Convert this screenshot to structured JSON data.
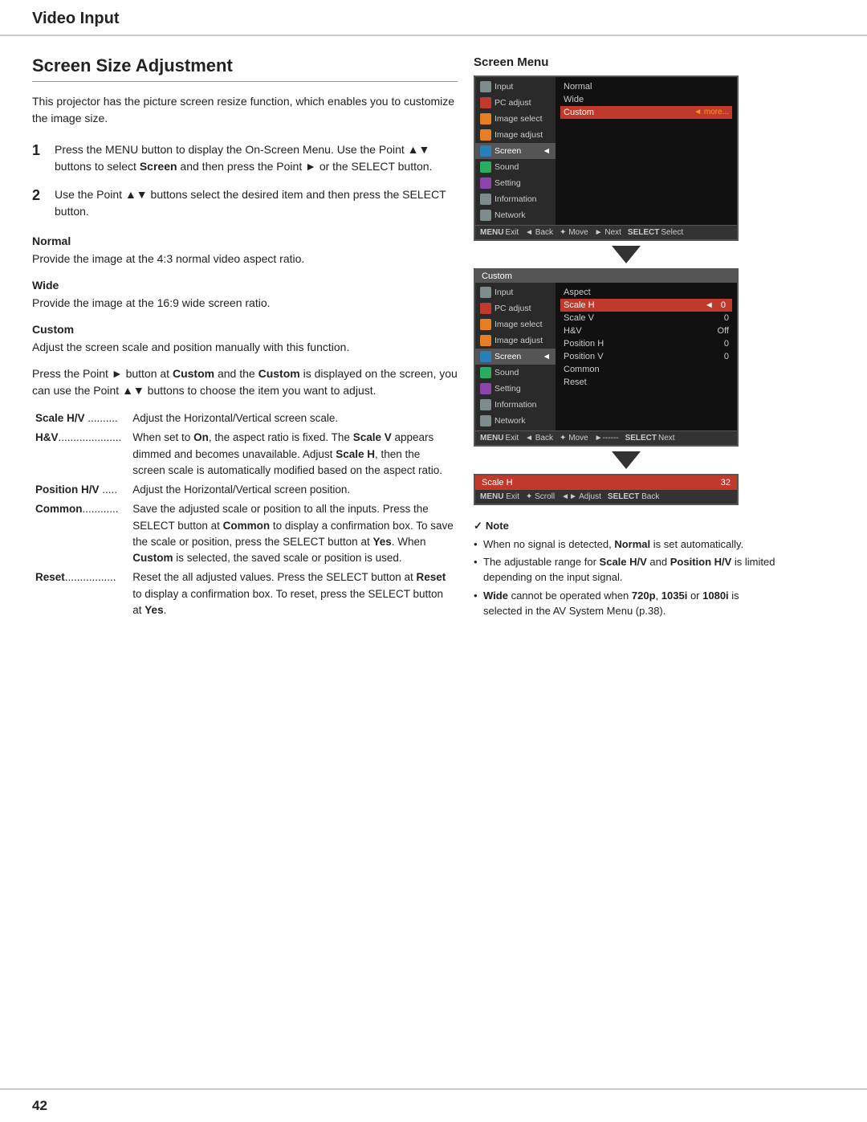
{
  "header": {
    "title": "Video Input"
  },
  "page": {
    "section_title": "Screen Size Adjustment",
    "intro": "This projector has the picture screen resize function, which enables you to customize the image size.",
    "steps": [
      {
        "num": "1",
        "text": "Press the MENU button to display the On-Screen Menu. Use the Point ▲▼ buttons to select Screen and then press the Point ► or the SELECT button."
      },
      {
        "num": "2",
        "text": "Use the Point ▲▼ buttons select the desired item and then press the SELECT button."
      }
    ],
    "normal_label": "Normal",
    "normal_desc": "Provide the image at the 4:3 normal video aspect ratio.",
    "wide_label": "Wide",
    "wide_desc": "Provide the image at the 16:9 wide screen ratio.",
    "custom_label": "Custom",
    "custom_desc1": "Adjust the screen scale and position manually with this function.",
    "custom_desc2": "Press the Point ► button at Custom and the Custom is displayed on the screen, you can use the Point ▲▼ buttons to choose the item you want to adjust.",
    "def_items": [
      {
        "term": "Scale H/V ..........",
        "def": "Adjust the Horizontal/Vertical screen scale."
      },
      {
        "term": "H&V...................",
        "def": "When set to On, the aspect ratio is fixed. The Scale V appears dimmed and becomes unavailable. Adjust Scale H, then the screen scale is automatically modified based on the aspect ratio."
      },
      {
        "term": "Position H/V .....",
        "def": "Adjust the Horizontal/Vertical screen position."
      },
      {
        "term": "Common............",
        "def": "Save the adjusted scale or position to all the inputs. Press the SELECT button at Common to display a confirmation box. To save the scale or position, press the SELECT button at Yes. When Custom is selected, the saved scale or position is used."
      },
      {
        "term": "Reset.................",
        "def": "Reset the all adjusted values. Press the SELECT button at Reset to display a confirmation box. To reset, press the SELECT button at Yes."
      }
    ]
  },
  "screen_menu": {
    "label": "Screen Menu",
    "osd1": {
      "left_items": [
        {
          "label": "Input",
          "icon": "gray"
        },
        {
          "label": "PC adjust",
          "icon": "red"
        },
        {
          "label": "Image select",
          "icon": "orange"
        },
        {
          "label": "Image adjust",
          "icon": "orange"
        },
        {
          "label": "Screen",
          "icon": "blue",
          "highlighted": true
        },
        {
          "label": "Sound",
          "icon": "green"
        },
        {
          "label": "Setting",
          "icon": "purple"
        },
        {
          "label": "Information",
          "icon": "gray"
        },
        {
          "label": "Network",
          "icon": "gray"
        }
      ],
      "right_items": [
        {
          "label": "Normal"
        },
        {
          "label": "Wide"
        },
        {
          "label": "Custom",
          "selected": true,
          "more": "◄ more..."
        }
      ],
      "statusbar": [
        "MENU Exit",
        "◄ Back",
        "✦ Move",
        "► Next",
        "SELECT Select"
      ]
    },
    "osd2": {
      "title": "Custom",
      "left_items": [
        {
          "label": "Input",
          "icon": "gray"
        },
        {
          "label": "PC adjust",
          "icon": "red"
        },
        {
          "label": "Image select",
          "icon": "orange"
        },
        {
          "label": "Image adjust",
          "icon": "orange"
        },
        {
          "label": "Screen",
          "icon": "blue",
          "highlighted": true
        },
        {
          "label": "Sound",
          "icon": "green"
        },
        {
          "label": "Setting",
          "icon": "purple"
        },
        {
          "label": "Information",
          "icon": "gray"
        },
        {
          "label": "Network",
          "icon": "gray"
        }
      ],
      "right_items": [
        {
          "label": "Aspect"
        },
        {
          "label": "Scale H",
          "selected": true,
          "value": "0"
        },
        {
          "label": "Scale V",
          "value": "0"
        },
        {
          "label": "H&V",
          "value": "Off"
        },
        {
          "label": "Position H",
          "value": "0"
        },
        {
          "label": "Position V",
          "value": "0"
        },
        {
          "label": "Common"
        },
        {
          "label": "Reset"
        }
      ],
      "statusbar": [
        "MENU Exit",
        "◄ Back",
        "✦ Move",
        "►------",
        "SELECT Next"
      ]
    },
    "osd3": {
      "scale_label": "Scale H",
      "scale_value": "32",
      "statusbar": [
        "MENU Exit",
        "✦ Scroll",
        "◄► Adjust",
        "SELECT Back"
      ]
    }
  },
  "note": {
    "title": "✓Note",
    "items": [
      "When no signal is detected, Normal is set automatically.",
      "The adjustable range for Scale H/V and Position H/V is limited depending on the input signal.",
      "Wide cannot be operated when 720p, 1035i or 1080i is selected in the AV System Menu (p.38)."
    ]
  },
  "footer": {
    "page_number": "42"
  }
}
